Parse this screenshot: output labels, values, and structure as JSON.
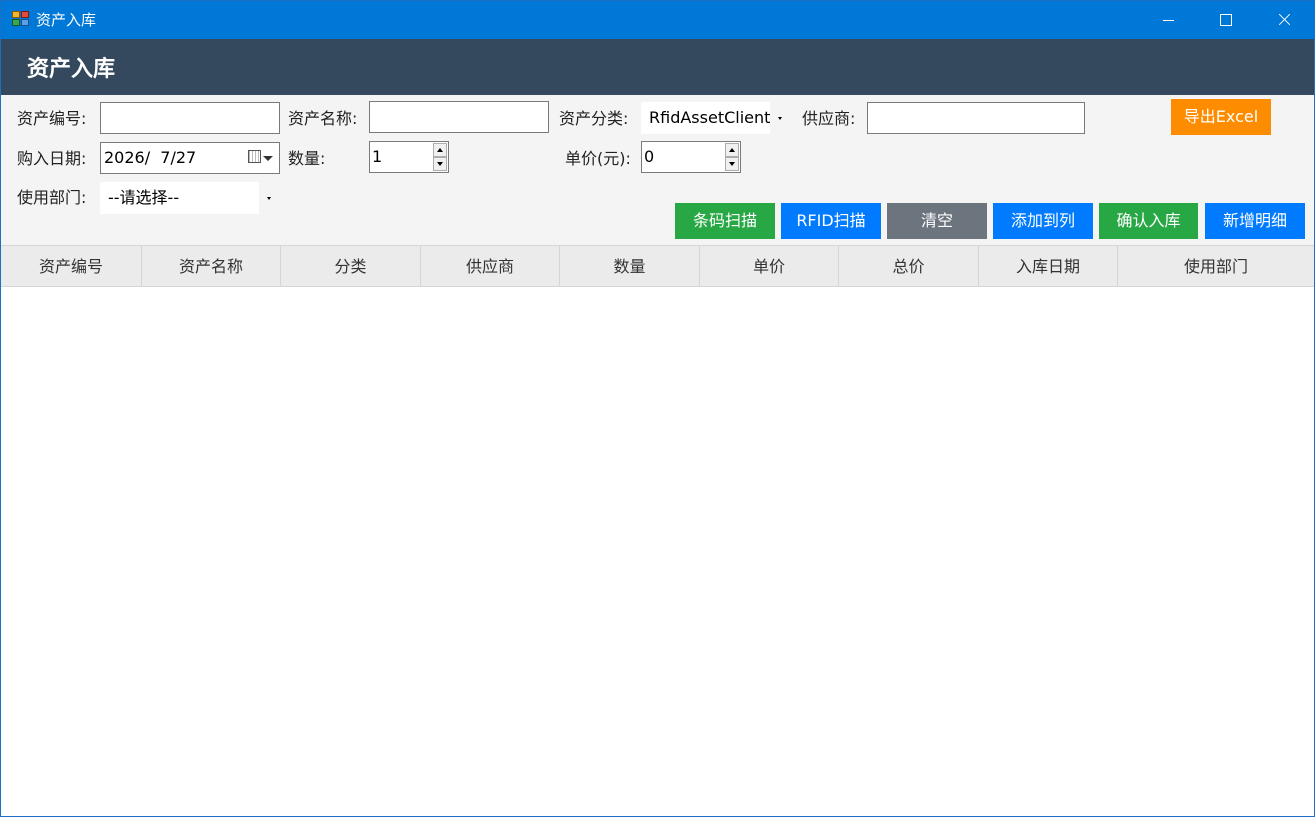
{
  "window": {
    "title": "资产入库"
  },
  "header": {
    "title": "资产入库"
  },
  "form": {
    "asset_code_label": "资产编号:",
    "asset_code_value": "",
    "asset_name_label": "资产名称:",
    "asset_name_value": "",
    "category_label": "资产分类:",
    "category_value": "RfidAssetClient",
    "supplier_label": "供应商:",
    "supplier_value": "",
    "purchase_date_label": "购入日期:",
    "purchase_date_value": "2026/  7/27",
    "quantity_label": "数量:",
    "quantity_value": "1",
    "unit_price_label": "单价(元):",
    "unit_price_value": "0",
    "department_label": "使用部门:",
    "department_value": "--请选择--"
  },
  "buttons": {
    "export_excel": "导出Excel",
    "barcode_scan": "条码扫描",
    "rfid_scan": "RFID扫描",
    "clear": "清空",
    "add_to_list": "添加到列",
    "confirm_inbound": "确认入库",
    "add_detail": "新增明细"
  },
  "table": {
    "columns": [
      "资产编号",
      "资产名称",
      "分类",
      "供应商",
      "数量",
      "单价",
      "总价",
      "入库日期",
      "使用部门"
    ],
    "rows": []
  },
  "colors": {
    "titlebar": "#0078d7",
    "header": "#34495e",
    "green": "#28a745",
    "blue": "#007bff",
    "gray": "#6c757d",
    "orange": "#fd8c00"
  }
}
